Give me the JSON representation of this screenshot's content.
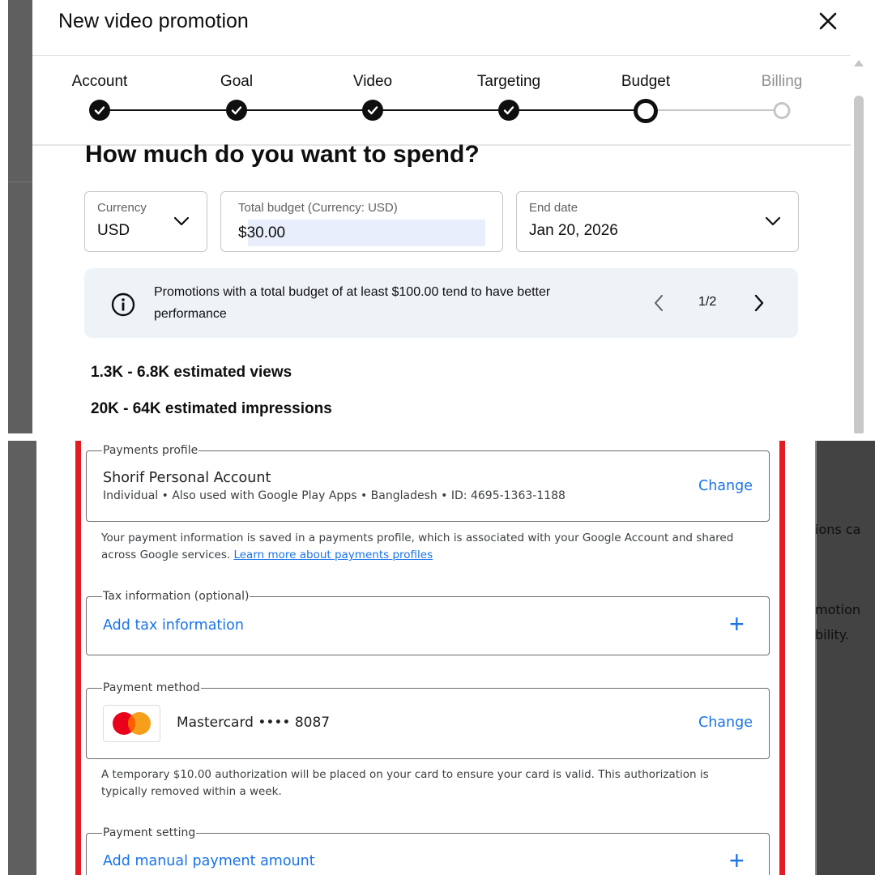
{
  "dialog": {
    "title": "New video promotion",
    "close_icon": "close-icon"
  },
  "stepper": {
    "steps": [
      {
        "label": "Account",
        "state": "done"
      },
      {
        "label": "Goal",
        "state": "done"
      },
      {
        "label": "Video",
        "state": "done"
      },
      {
        "label": "Targeting",
        "state": "done"
      },
      {
        "label": "Budget",
        "state": "current"
      },
      {
        "label": "Billing",
        "state": "upcoming"
      }
    ]
  },
  "budget": {
    "question": "How much do you want to spend?",
    "currency": {
      "label": "Currency",
      "value": "USD"
    },
    "total": {
      "label": "Total budget (Currency: USD)",
      "value": "$30.00"
    },
    "end_date": {
      "label": "End date",
      "value": "Jan 20, 2026"
    }
  },
  "info": {
    "icon": "info-icon",
    "text": "Promotions with a total budget of at least $100.00 tend to have better performance",
    "pager": "1/2"
  },
  "estimates": {
    "views": "1.3K - 6.8K estimated views",
    "impressions": "20K - 64K estimated impressions"
  },
  "billing": {
    "payments_profile": {
      "legend": "Payments profile",
      "name": "Shorif Personal Account",
      "details": "Individual • Also used with Google Play Apps • Bangladesh • ID: 4695-1363-1188",
      "change_label": "Change"
    },
    "profile_note": "Your payment information is saved in a payments profile, which is associated with your Google Account and shared across Google services.",
    "profile_link": "Learn more about payments profiles",
    "tax": {
      "legend": "Tax information (optional)",
      "action": "Add tax information"
    },
    "payment_method": {
      "legend": "Payment method",
      "card": "Mastercard •••• 8087",
      "change_label": "Change"
    },
    "auth_note": "A temporary $10.00 authorization will be placed on your card to ensure your card is valid. This authorization is typically removed within a week.",
    "payment_setting": {
      "legend": "Payment setting",
      "action": "Add manual payment amount"
    },
    "background_fragments": [
      "ions ca",
      "motion",
      "bility."
    ]
  },
  "colors": {
    "accent_blue": "#1a73e8",
    "highlight_border": "#e31b23",
    "info_bg": "#eef3f8"
  }
}
